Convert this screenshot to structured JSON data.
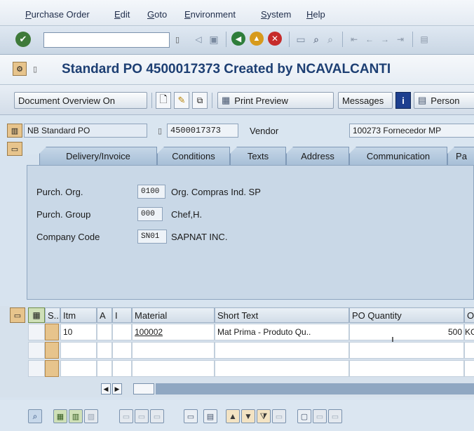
{
  "menu": [
    "Purchase Order",
    "Edit",
    "Goto",
    "Environment",
    "System",
    "Help"
  ],
  "title": "Standard PO 4500017373 Created by NCAVALCANTI",
  "app_toolbar": {
    "doc_overview": "Document Overview On",
    "print_preview": "Print Preview",
    "messages": "Messages",
    "personal": "Person"
  },
  "header": {
    "po_type": "NB Standard PO",
    "po_number": "4500017373",
    "vendor_label": "Vendor",
    "vendor_value": "100273 Fornecedor MP"
  },
  "tabs": [
    "Delivery/Invoice",
    "Conditions",
    "Texts",
    "Address",
    "Communication",
    "Pa"
  ],
  "org": [
    {
      "label": "Purch. Org.",
      "code": "0100",
      "desc": "Org. Compras Ind. SP"
    },
    {
      "label": "Purch. Group",
      "code": "000",
      "desc": "Chef,H."
    },
    {
      "label": "Company Code",
      "code": "SN01",
      "desc": "SAPNAT INC."
    }
  ],
  "items_table": {
    "headers": {
      "s": "S..",
      "itm": "Itm",
      "a": "A",
      "i": "I",
      "material": "Material",
      "short_text": "Short Text",
      "po_qty": "PO Quantity",
      "o": "O"
    },
    "rows": [
      {
        "itm": "10",
        "material": "100002",
        "short_text": "Mat Prima - Produto Qu..",
        "po_qty": "500",
        "o": "KG"
      }
    ]
  },
  "colors": {
    "title": "#1d3f73",
    "panel": "#c9d8e7",
    "selector": "#e7c48c"
  }
}
